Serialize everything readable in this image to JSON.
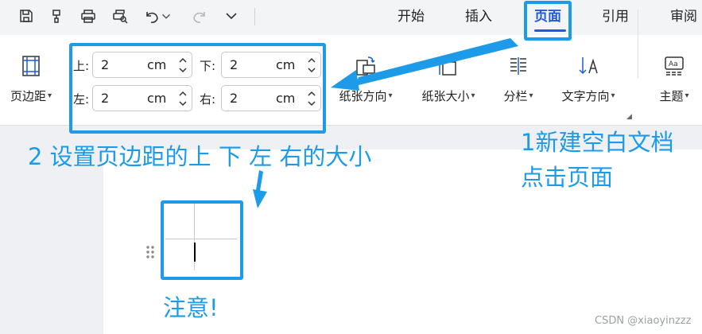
{
  "tabs": [
    "开始",
    "插入",
    "页面",
    "引用",
    "审阅"
  ],
  "active_tab": "页面",
  "quick_access_icons": [
    "save-icon",
    "format-painter-icon",
    "print-icon",
    "print-preview-icon",
    "undo-icon",
    "undo-dropdown-icon",
    "redo-icon",
    "customize-dropdown-icon"
  ],
  "ribbon": {
    "margins_button": "页边距",
    "margins": {
      "top_label": "上:",
      "top_value": "2",
      "top_unit": "cm",
      "bottom_label": "下:",
      "bottom_value": "2",
      "bottom_unit": "cm",
      "left_label": "左:",
      "left_value": "2",
      "left_unit": "cm",
      "right_label": "右:",
      "right_value": "2",
      "right_unit": "cm"
    },
    "orientation_button": "纸张方向",
    "size_button": "纸张大小",
    "columns_button": "分栏",
    "text_direction_button": "文字方向",
    "theme_button": "主题"
  },
  "annotations": {
    "step1_line1": "1新建空白文档",
    "step1_line2": "点击页面",
    "step2": "2 设置页边距的上 下 左 右的大小",
    "note": "注意!"
  },
  "watermark": "CSDN @xiaoyinzzz",
  "colors": {
    "accent": "#1f5bd9",
    "annotation": "#1e9be8"
  }
}
